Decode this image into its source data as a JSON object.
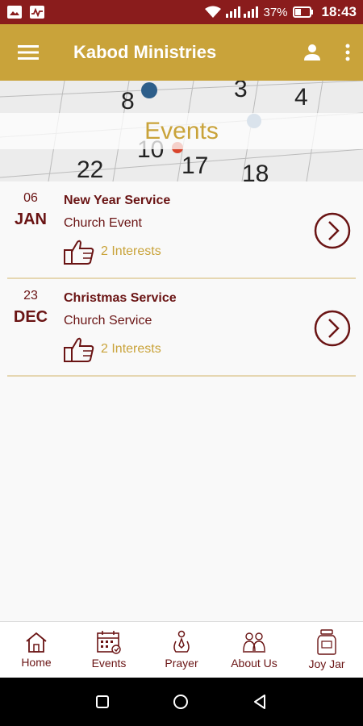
{
  "status_bar": {
    "battery": "37%",
    "time": "18:43"
  },
  "app_bar": {
    "title": "Kabod Ministries"
  },
  "banner": {
    "title": "Events"
  },
  "events": [
    {
      "day": "06",
      "month": "JAN",
      "title": "New Year Service",
      "type": "Church Event",
      "interests": "2 Interests"
    },
    {
      "day": "23",
      "month": "DEC",
      "title": "Christmas Service",
      "type": "Church Service",
      "interests": "2 Interests"
    }
  ],
  "bottom_nav": {
    "items": [
      {
        "label": "Home"
      },
      {
        "label": "Events"
      },
      {
        "label": "Prayer"
      },
      {
        "label": "About Us"
      },
      {
        "label": "Joy Jar"
      }
    ]
  },
  "colors": {
    "primary_gold": "#c9a33a",
    "maroon": "#6a1414",
    "status_bar": "#8a1c1c"
  }
}
